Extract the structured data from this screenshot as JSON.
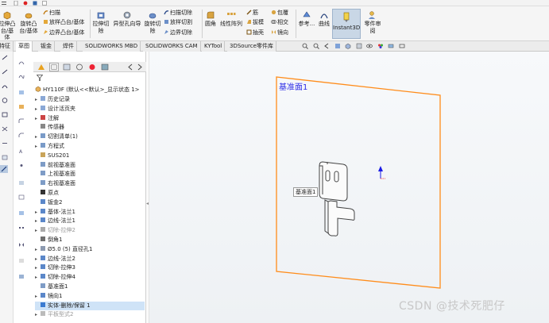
{
  "ribbon": {
    "extrude_boss": "拉伸凸台/基体",
    "revolve_boss": "旋转凸台/基体",
    "sweep": "扫描",
    "loft_boss": "放样凸台/基体",
    "boundary_boss": "边界凸台/基体",
    "extrude_cut": "拉伸切除",
    "hole_wizard": "异型孔向导",
    "revolve_cut": "旋转切除",
    "swept_cut": "扫描切除",
    "lofted_cut": "放样切割",
    "boundary_cut": "边界切除",
    "fillet": "圆角",
    "linear_pattern": "线性阵列",
    "rib": "筋",
    "draft": "拔模",
    "shell": "抽壳",
    "wrap": "包覆",
    "intersect": "相交",
    "mirror": "镜向",
    "reference": "参考...",
    "curves": "曲线",
    "instant3d": "Instant3D",
    "part_review": "零件审阅"
  },
  "tabs": [
    "特征",
    "草图",
    "钣金",
    "焊件",
    "SOLIDWORKS MBD",
    "SOLIDWORKS CAM",
    "KYTool",
    "3DSource零件库"
  ],
  "tree": {
    "root": "HY110F (默认<<默认>_显示状态 1>",
    "items": [
      {
        "label": "历史记录",
        "arrow": "▸",
        "dim": false
      },
      {
        "label": "设计活页夹",
        "arrow": "▸",
        "dim": false
      },
      {
        "label": "注解",
        "arrow": "▸",
        "dim": false
      },
      {
        "label": "传感器",
        "arrow": "",
        "dim": false
      },
      {
        "label": "切割清单(1)",
        "arrow": "▸",
        "dim": false
      },
      {
        "label": "方程式",
        "arrow": "▸",
        "dim": false
      },
      {
        "label": "SUS201",
        "arrow": "",
        "dim": false
      },
      {
        "label": "前视基准面",
        "arrow": "",
        "dim": false
      },
      {
        "label": "上视基准面",
        "arrow": "",
        "dim": false
      },
      {
        "label": "右视基准面",
        "arrow": "",
        "dim": false
      },
      {
        "label": "原点",
        "arrow": "",
        "dim": false
      },
      {
        "label": "钣金2",
        "arrow": "",
        "dim": false
      },
      {
        "label": "基体-法兰1",
        "arrow": "▸",
        "dim": false
      },
      {
        "label": "边线-法兰1",
        "arrow": "▸",
        "dim": false
      },
      {
        "label": "切除-拉伸2",
        "arrow": "▸",
        "dim": true
      },
      {
        "label": "倒角1",
        "arrow": "",
        "dim": false
      },
      {
        "label": "Ø5.0 (5) 直径孔1",
        "arrow": "▸",
        "dim": false
      },
      {
        "label": "边线-法兰2",
        "arrow": "▸",
        "dim": false
      },
      {
        "label": "切除-拉伸3",
        "arrow": "▸",
        "dim": false
      },
      {
        "label": "切除-拉伸4",
        "arrow": "▸",
        "dim": false
      },
      {
        "label": "基准面1",
        "arrow": "",
        "dim": false
      },
      {
        "label": "镜向1",
        "arrow": "▸",
        "dim": false
      },
      {
        "label": "实体-删除/保留 1",
        "arrow": "",
        "dim": false,
        "selected": true
      },
      {
        "label": "平板型式2",
        "arrow": "▸",
        "dim": true
      }
    ]
  },
  "viewport": {
    "plane_label": "基准面1",
    "plane_tag": "基准面1",
    "watermark": "CSDN @技术死肥仔"
  },
  "colors": {
    "plane_edge": "#ff8c1a",
    "plane_label": "#2b2be6",
    "axis": "#1a1ae6",
    "selection": "#cfe3f7"
  }
}
